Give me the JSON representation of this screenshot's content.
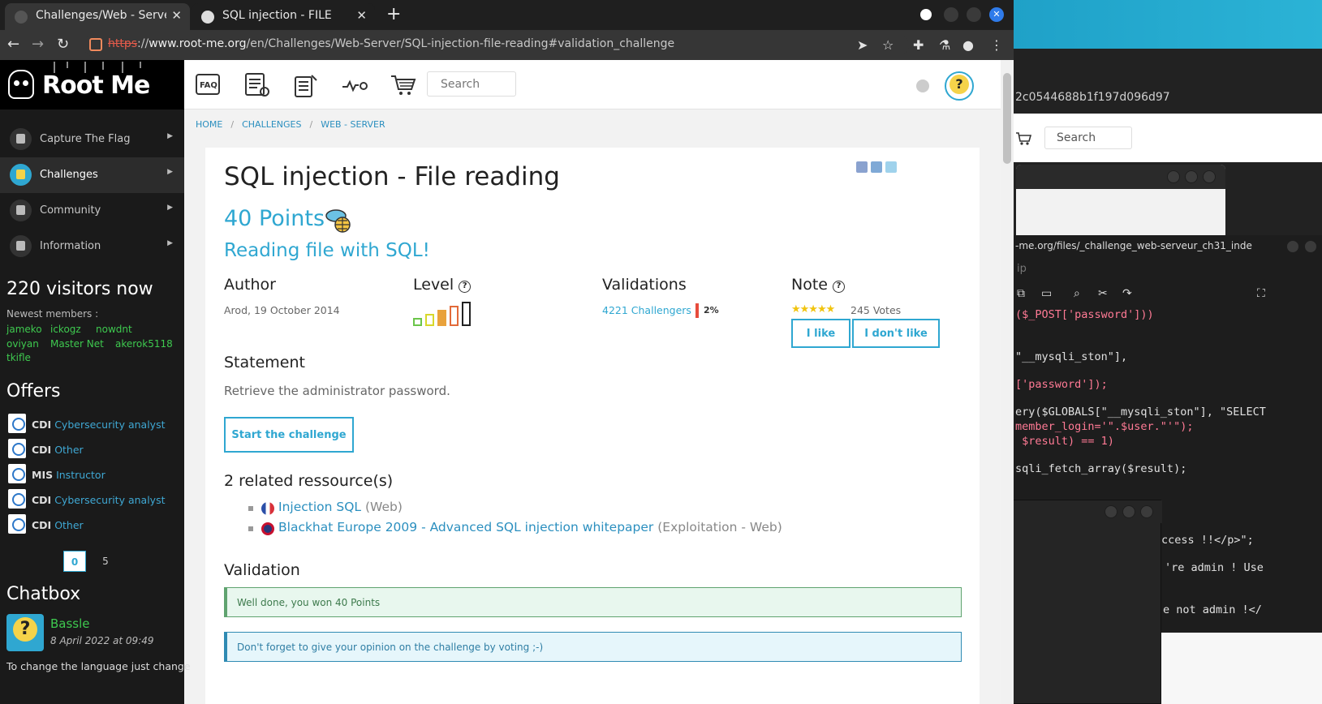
{
  "browser": {
    "tabs": [
      {
        "title": "Challenges/Web - Server",
        "active": true
      },
      {
        "title": "SQL injection - FILE",
        "active": false
      }
    ],
    "url": {
      "scheme": "https",
      "rest": "://",
      "host": "www.root-me.org",
      "path": "/en/Challenges/Web-Server/SQL-injection-file-reading#validation_challenge"
    }
  },
  "background": {
    "hash_text": "2c0544688b1f197d096d97",
    "search_placeholder": "Search",
    "editor_url": "-me.org/files/_challenge_web-serveur_ch31_inde",
    "editor_ip": "ip",
    "code_lines": [
      "($_POST['password']))",
      "\"__mysqli_ston\"],",
      "['password']);",
      "ery($GLOBALS[\"__mysqli_ston\"], \"SELECT",
      "member_login='\".$user.\"'\");",
      " $result) == 1)",
      "sqli_fetch_array($result);",
      "ccess !!</p>\";",
      "'re admin ! Use",
      "e not admin !</"
    ]
  },
  "sidebar": {
    "logo_text": "Root Me",
    "menu": [
      {
        "label": "Capture The Flag",
        "active": false
      },
      {
        "label": "Challenges",
        "active": true
      },
      {
        "label": "Community",
        "active": false
      },
      {
        "label": "Information",
        "active": false
      }
    ],
    "visitors": "220 visitors now",
    "newest_label": "Newest members :",
    "members": [
      "jameko",
      "ickogz",
      "nowdnt",
      "oviyan",
      "Master Net",
      "akerok5118",
      "tkifle"
    ],
    "offers_title": "Offers",
    "offers": [
      {
        "type": "CDI",
        "label": "Cybersecurity analyst"
      },
      {
        "type": "CDI",
        "label": "Other"
      },
      {
        "type": "MIS",
        "label": "Instructor"
      },
      {
        "type": "CDI",
        "label": "Cybersecurity analyst"
      },
      {
        "type": "CDI",
        "label": "Other"
      }
    ],
    "pager": {
      "current": "0",
      "next": "5"
    },
    "chatbox_title": "Chatbox",
    "chat": {
      "name": "Bassle",
      "date": "8 April 2022 at 09:49",
      "message": "To change the language just change"
    }
  },
  "topnav": {
    "search_placeholder": "Search"
  },
  "breadcrumb": [
    "HOME",
    "CHALLENGES",
    "WEB - SERVER"
  ],
  "challenge": {
    "title": "SQL injection - File reading",
    "points": "40 Points",
    "subtitle": "Reading file with SQL!",
    "author_label": "Author",
    "author_value": "Arod,  19 October 2014",
    "level_label": "Level",
    "level": 4,
    "level_max": 5,
    "validations_label": "Validations",
    "validations_value": "4221 Challengers",
    "validations_pct": "2%",
    "note_label": "Note",
    "stars": "★★★★★",
    "votes": "245 Votes",
    "like_label": "I like",
    "dislike_label": "I don't like",
    "statement_label": "Statement",
    "statement": "Retrieve the administrator password.",
    "start_label": "Start the challenge",
    "related_title": "2 related ressource(s)",
    "related": [
      {
        "title": "Injection SQL",
        "category": "(Web)"
      },
      {
        "title": "Blackhat Europe 2009 - Advanced SQL injection whitepaper",
        "category": "(Exploitation - Web)"
      }
    ],
    "validation_title": "Validation",
    "success_msg": "Well done, you won 40 Points",
    "info_msg": "Don't forget to give your opinion on the challenge by voting ;-)"
  },
  "colors": {
    "accent": "#2fa7d1",
    "success": "#3ec94f",
    "danger": "#e74c3c"
  }
}
